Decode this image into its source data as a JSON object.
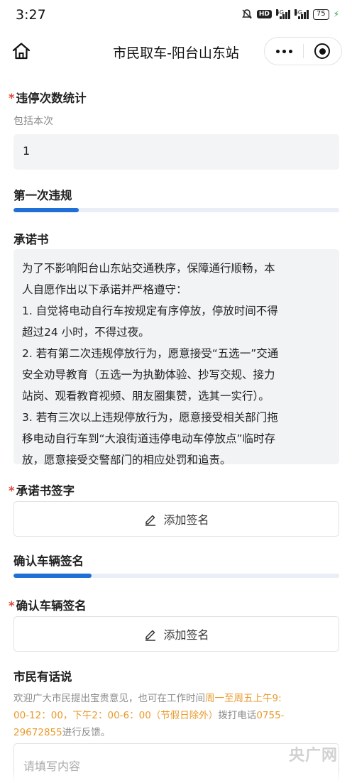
{
  "status_bar": {
    "time": "3:27",
    "hd_badge": "HD",
    "signal_1": "5G",
    "signal_2": "5G",
    "battery": "75"
  },
  "nav": {
    "title": "市民取车-阳台山东站"
  },
  "violation_count": {
    "required_mark": "*",
    "label": "违停次数统计",
    "hint": "包括本次",
    "value": "1"
  },
  "first_violation": {
    "title": "第一次违规",
    "progress": 0.2
  },
  "pledge": {
    "title": "承诺书",
    "lines": [
      "为了不影响阳台山东站交通秩序，保障通行顺畅，本",
      "人自愿作出以下承诺并严格遵守：",
      "1. 自觉将电动自行车按规定有序停放，停放时间不得",
      "超过24 小时，不得过夜。",
      "2. 若有第二次违规停放行为，愿意接受“五选一”交通",
      "安全劝导教育（五选一为执勤体验、抄写交规、接力",
      "站岗、观看教育视频、朋友圈集赞，选其一实行）。",
      "3. 若有三次以上违规停放行为，愿意接受相关部门拖",
      "移电动自行车到“大浪街道违停电动车停放点”临时存",
      "放，愿意接受交警部门的相应处罚和追责。"
    ]
  },
  "pledge_signature": {
    "required_mark": "*",
    "label": "承诺书签字",
    "button_label": "添加签名"
  },
  "confirm_section": {
    "title": "确认车辆签名",
    "progress": 0.24
  },
  "confirm_signature": {
    "required_mark": "*",
    "label": "确认车辆签名",
    "button_label": "添加签名"
  },
  "citizen_voice": {
    "title": "市民有话说",
    "notice_1": "欢迎广大市民提出宝贵意见，也可在工作时间",
    "notice_hl_1": "周一至周五上午9:",
    "notice_hl_2": "00-12：00，下午2：00-6：00（节假日除外）",
    "notice_2": "拨打电话",
    "notice_phone_a": "0755-",
    "notice_phone_b": "29672855",
    "notice_3": "进行反馈。",
    "placeholder": "请填写内容"
  },
  "watermark": "央广网",
  "colors": {
    "accent": "#1f6fd6",
    "required": "#e04a3a",
    "highlight": "#e99a2c"
  },
  "icons": [
    "home-icon",
    "more-icon",
    "close-circle-icon",
    "pen-icon"
  ]
}
